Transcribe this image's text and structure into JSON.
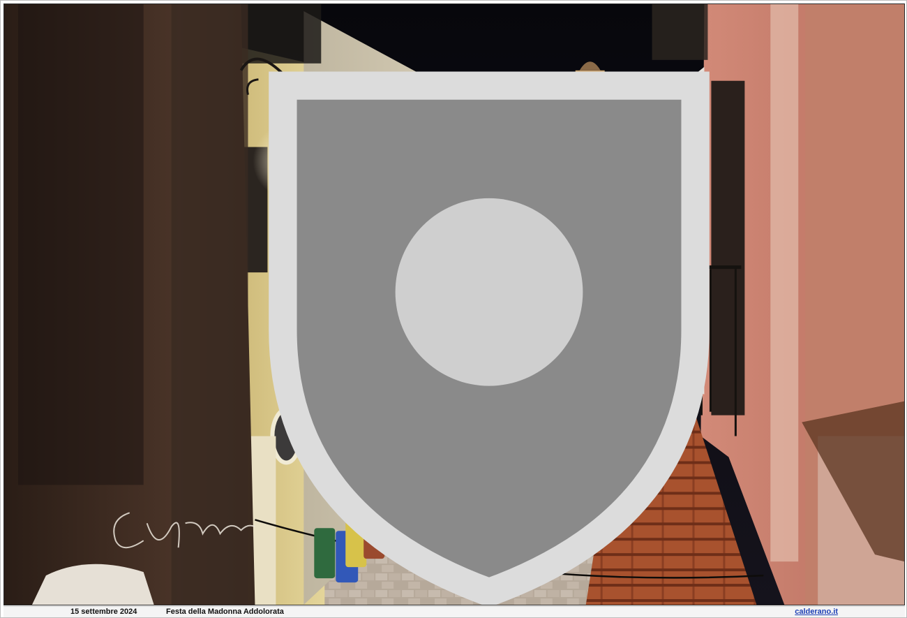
{
  "caption": {
    "date": "15 settembre 2024",
    "event": "Festa della Madonna Addolorata",
    "website": "calderano.it"
  },
  "watermark": {
    "signature": "Cay Calderano",
    "crest_icon": "town-crest-icon"
  },
  "colors": {
    "night_sky": "#0b0a10",
    "pink_facade": "#c4786a",
    "yellow_facade": "#d9c98a",
    "illumination_purple": "#9a3fd0",
    "illumination_white": "#e8f2ff",
    "roof_tiles": "#a8522e",
    "link_blue": "#1d3fb5"
  }
}
